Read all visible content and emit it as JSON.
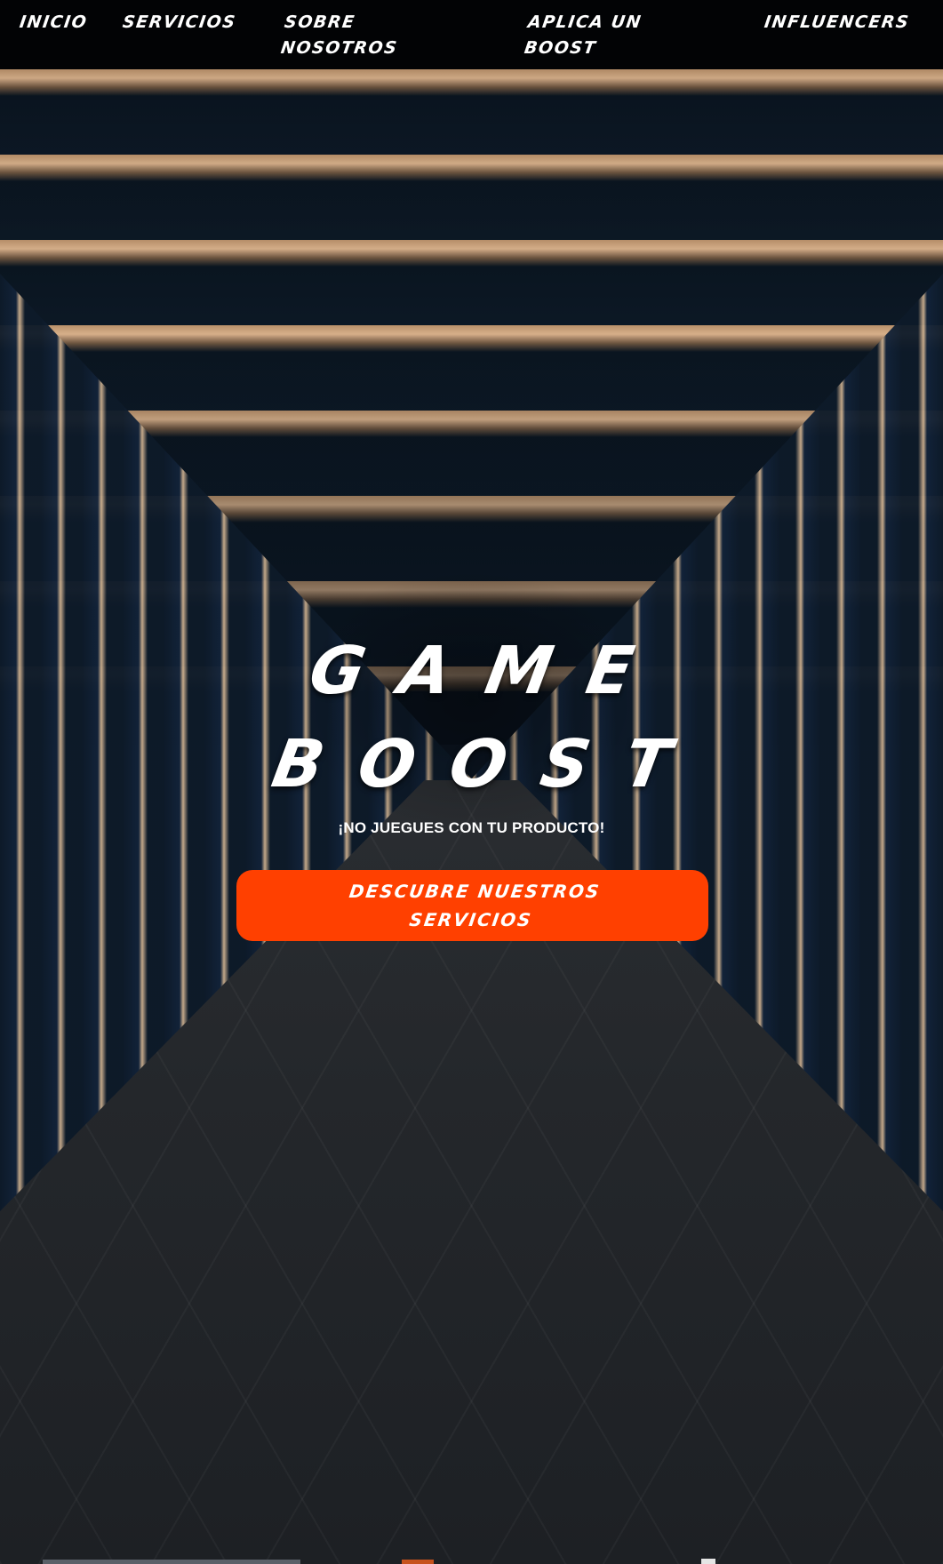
{
  "nav": {
    "items": [
      {
        "label": "INICIO"
      },
      {
        "label": "SERVICIOS"
      },
      {
        "label": "SOBRE NOSOTROS"
      },
      {
        "label": "APLICA UN BOOST"
      },
      {
        "label": "INFLUENCERS"
      }
    ]
  },
  "hero": {
    "title_line1": "GAME",
    "title_line2": "BOOST",
    "tagline": "¡NO JUEGUES CON TU PRODUCTO!",
    "cta_label": "DESCUBRE NUESTROS SERVICIOS"
  },
  "colors": {
    "nav_background": "#020305",
    "accent": "#ff4000",
    "text": "#ffffff"
  }
}
